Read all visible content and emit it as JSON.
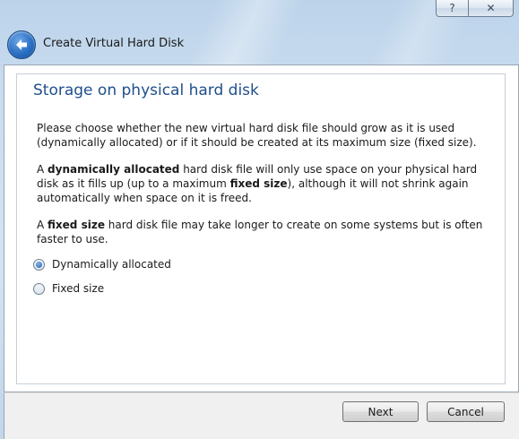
{
  "window": {
    "caption_buttons": {
      "help": "?",
      "close": "✕"
    },
    "title": "Create Virtual Hard Disk"
  },
  "page": {
    "heading": "Storage on physical hard disk",
    "paragraph1": "Please choose whether the new virtual hard disk file should grow as it is used (dynamically allocated) or if it should be created at its maximum size (fixed size).",
    "paragraph2": {
      "part1": "A ",
      "bold1": "dynamically allocated",
      "part2": " hard disk file will only use space on your physical hard disk as it fills up (up to a maximum ",
      "bold2": "fixed size",
      "part3": "), although it will not shrink again automatically when space on it is freed."
    },
    "paragraph3": {
      "part1": "A ",
      "bold1": "fixed size",
      "part2": " hard disk file may take longer to create on some systems but is often faster to use."
    },
    "options": [
      {
        "label": "Dynamically allocated",
        "checked": true
      },
      {
        "label": "Fixed size",
        "checked": false
      }
    ]
  },
  "footer": {
    "next_label": "Next",
    "cancel_label": "Cancel"
  },
  "icons": {
    "back": "back-arrow-icon",
    "help": "help-icon",
    "close": "close-icon"
  }
}
